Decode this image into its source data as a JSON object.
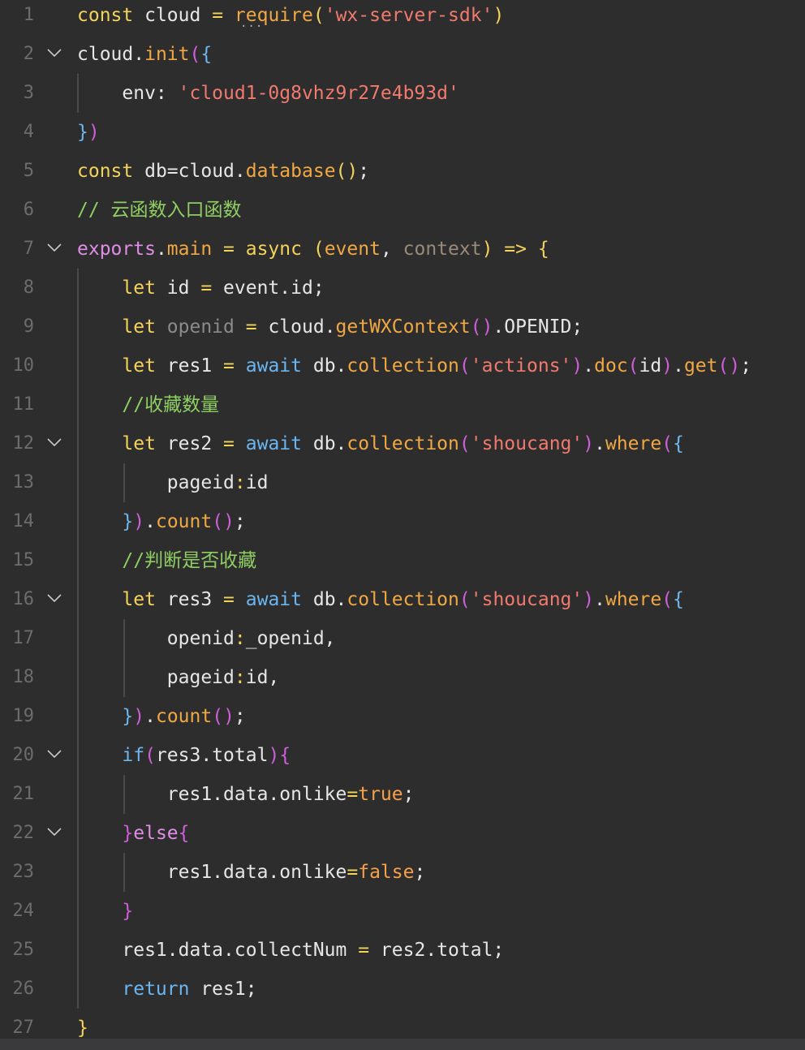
{
  "editor": {
    "line_numbers": [
      "1",
      "2",
      "3",
      "4",
      "5",
      "6",
      "7",
      "8",
      "9",
      "10",
      "11",
      "12",
      "13",
      "14",
      "15",
      "16",
      "17",
      "18",
      "19",
      "20",
      "21",
      "22",
      "23",
      "24",
      "25",
      "26",
      "27"
    ],
    "fold_lines": [
      "2",
      "7",
      "12",
      "16",
      "20",
      "22"
    ],
    "hint_marker": "...",
    "lines": [
      [
        [
          "const",
          "kw"
        ],
        [
          " cloud ",
          "id"
        ],
        [
          "=",
          "kw"
        ],
        [
          " ",
          "id"
        ],
        [
          "require",
          "fn"
        ],
        [
          "(",
          "kw"
        ],
        [
          "'",
          "str"
        ],
        [
          "wx-server-sdk",
          "str"
        ],
        [
          "'",
          "str"
        ],
        [
          ")",
          "kw"
        ]
      ],
      [
        [
          "cloud",
          "id"
        ],
        [
          ".",
          "op"
        ],
        [
          "init",
          "fn"
        ],
        [
          "(",
          "pu"
        ],
        [
          "{",
          "bl"
        ]
      ],
      [
        [
          "    env: ",
          "id"
        ],
        [
          "'",
          "str"
        ],
        [
          "cloud1-0g8vhz9r27e4b93d",
          "str"
        ],
        [
          "'",
          "str"
        ]
      ],
      [
        [
          "}",
          "bl"
        ],
        [
          ")",
          "pu"
        ]
      ],
      [
        [
          "const",
          "kw"
        ],
        [
          " db",
          "id"
        ],
        [
          "=",
          "op"
        ],
        [
          "cloud",
          "id"
        ],
        [
          ".",
          "op"
        ],
        [
          "database",
          "fn"
        ],
        [
          "()",
          "kw"
        ],
        [
          ";",
          "id"
        ]
      ],
      [
        [
          "// 云函数入口函数",
          "cm"
        ]
      ],
      [
        [
          "exports",
          "ex"
        ],
        [
          ".",
          "op"
        ],
        [
          "main",
          "fn"
        ],
        [
          " = ",
          "kw"
        ],
        [
          "async",
          "kw"
        ],
        [
          " ",
          "id"
        ],
        [
          "(",
          "kw"
        ],
        [
          "event",
          "fn"
        ],
        [
          ", ",
          "id"
        ],
        [
          "context",
          "dim"
        ],
        [
          ")",
          "kw"
        ],
        [
          " => ",
          "kw"
        ],
        [
          "{",
          "kw"
        ]
      ],
      [
        [
          "    ",
          "id"
        ],
        [
          "let",
          "kw"
        ],
        [
          " id ",
          "id"
        ],
        [
          "=",
          "kw"
        ],
        [
          " event",
          "id"
        ],
        [
          ".",
          "op"
        ],
        [
          "id;",
          "id"
        ]
      ],
      [
        [
          "    ",
          "id"
        ],
        [
          "let",
          "kw"
        ],
        [
          " ",
          "id"
        ],
        [
          "openid",
          "dim2"
        ],
        [
          " = ",
          "kw"
        ],
        [
          "cloud",
          "id"
        ],
        [
          ".",
          "op"
        ],
        [
          "getWXContext",
          "fn"
        ],
        [
          "()",
          "pu"
        ],
        [
          ".",
          "op"
        ],
        [
          "OPENID;",
          "id"
        ]
      ],
      [
        [
          "    ",
          "id"
        ],
        [
          "let",
          "kw"
        ],
        [
          " res1 ",
          "id"
        ],
        [
          "=",
          "kw"
        ],
        [
          " ",
          "id"
        ],
        [
          "await",
          "bl"
        ],
        [
          " db",
          "id"
        ],
        [
          ".",
          "op"
        ],
        [
          "collection",
          "fn"
        ],
        [
          "(",
          "pu"
        ],
        [
          "'",
          "str"
        ],
        [
          "actions",
          "str"
        ],
        [
          "'",
          "str"
        ],
        [
          ")",
          "pu"
        ],
        [
          ".",
          "op"
        ],
        [
          "doc",
          "fn"
        ],
        [
          "(",
          "pu"
        ],
        [
          "id",
          "id"
        ],
        [
          ")",
          "pu"
        ],
        [
          ".",
          "op"
        ],
        [
          "get",
          "fn"
        ],
        [
          "()",
          "pu"
        ],
        [
          ";",
          "id"
        ]
      ],
      [
        [
          "    //收藏数量",
          "cm"
        ]
      ],
      [
        [
          "    ",
          "id"
        ],
        [
          "let",
          "kw"
        ],
        [
          " res2 ",
          "id"
        ],
        [
          "=",
          "kw"
        ],
        [
          " ",
          "id"
        ],
        [
          "await",
          "bl"
        ],
        [
          " db",
          "id"
        ],
        [
          ".",
          "op"
        ],
        [
          "collection",
          "fn"
        ],
        [
          "(",
          "pu"
        ],
        [
          "'",
          "str"
        ],
        [
          "shoucang",
          "str"
        ],
        [
          "'",
          "str"
        ],
        [
          ")",
          "pu"
        ],
        [
          ".",
          "op"
        ],
        [
          "where",
          "fn"
        ],
        [
          "(",
          "pu"
        ],
        [
          "{",
          "bl"
        ]
      ],
      [
        [
          "        pageid",
          "id"
        ],
        [
          ":",
          "kw"
        ],
        [
          "id",
          "id"
        ]
      ],
      [
        [
          "    ",
          "id"
        ],
        [
          "}",
          "bl"
        ],
        [
          ")",
          "pu"
        ],
        [
          ".",
          "op"
        ],
        [
          "count",
          "fn"
        ],
        [
          "()",
          "pu"
        ],
        [
          ";",
          "id"
        ]
      ],
      [
        [
          "    //判断是否收藏",
          "cm"
        ]
      ],
      [
        [
          "    ",
          "id"
        ],
        [
          "let",
          "kw"
        ],
        [
          " res3 ",
          "id"
        ],
        [
          "=",
          "kw"
        ],
        [
          " ",
          "id"
        ],
        [
          "await",
          "bl"
        ],
        [
          " db",
          "id"
        ],
        [
          ".",
          "op"
        ],
        [
          "collection",
          "fn"
        ],
        [
          "(",
          "pu"
        ],
        [
          "'",
          "str"
        ],
        [
          "shoucang",
          "str"
        ],
        [
          "'",
          "str"
        ],
        [
          ")",
          "pu"
        ],
        [
          ".",
          "op"
        ],
        [
          "where",
          "fn"
        ],
        [
          "(",
          "pu"
        ],
        [
          "{",
          "bl"
        ]
      ],
      [
        [
          "        openid",
          "id"
        ],
        [
          ":",
          "kw"
        ],
        [
          "_openid,",
          "id"
        ]
      ],
      [
        [
          "        pageid",
          "id"
        ],
        [
          ":",
          "kw"
        ],
        [
          "id,",
          "id"
        ]
      ],
      [
        [
          "    ",
          "id"
        ],
        [
          "}",
          "bl"
        ],
        [
          ")",
          "pu"
        ],
        [
          ".",
          "op"
        ],
        [
          "count",
          "fn"
        ],
        [
          "()",
          "pu"
        ],
        [
          ";",
          "id"
        ]
      ],
      [
        [
          "    ",
          "id"
        ],
        [
          "if",
          "bl"
        ],
        [
          "(",
          "pu"
        ],
        [
          "res3",
          "id"
        ],
        [
          ".",
          "op"
        ],
        [
          "total",
          "id"
        ],
        [
          ")",
          "pu"
        ],
        [
          "{",
          "pu"
        ]
      ],
      [
        [
          "        res1",
          "id"
        ],
        [
          ".",
          "op"
        ],
        [
          "data",
          "id"
        ],
        [
          ".",
          "op"
        ],
        [
          "onlike",
          "id"
        ],
        [
          "=",
          "kw"
        ],
        [
          "true",
          "lit"
        ],
        [
          ";",
          "id"
        ]
      ],
      [
        [
          "    ",
          "id"
        ],
        [
          "}",
          "pu"
        ],
        [
          "else",
          "ex"
        ],
        [
          "{",
          "pu"
        ]
      ],
      [
        [
          "        res1",
          "id"
        ],
        [
          ".",
          "op"
        ],
        [
          "data",
          "id"
        ],
        [
          ".",
          "op"
        ],
        [
          "onlike",
          "id"
        ],
        [
          "=",
          "kw"
        ],
        [
          "false",
          "lit"
        ],
        [
          ";",
          "id"
        ]
      ],
      [
        [
          "    ",
          "id"
        ],
        [
          "}",
          "pu"
        ]
      ],
      [
        [
          "    res1",
          "id"
        ],
        [
          ".",
          "op"
        ],
        [
          "data",
          "id"
        ],
        [
          ".",
          "op"
        ],
        [
          "collectNum ",
          "id"
        ],
        [
          "=",
          "kw"
        ],
        [
          " res2",
          "id"
        ],
        [
          ".",
          "op"
        ],
        [
          "total;",
          "id"
        ]
      ],
      [
        [
          "    ",
          "id"
        ],
        [
          "return",
          "bl"
        ],
        [
          " res1;",
          "id"
        ]
      ],
      [
        [
          "}",
          "kw"
        ]
      ]
    ]
  }
}
